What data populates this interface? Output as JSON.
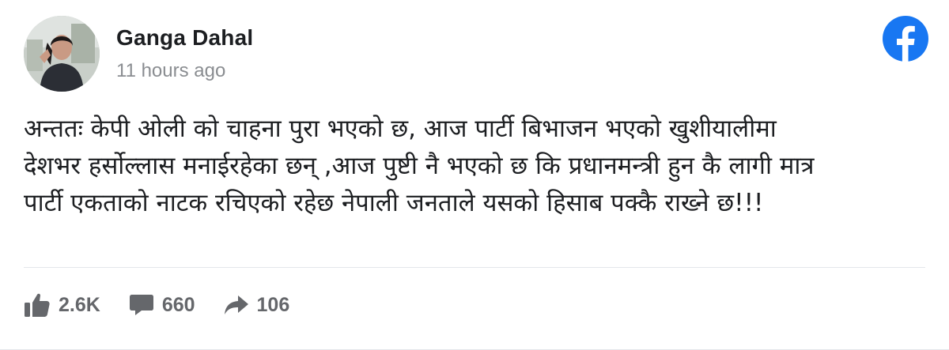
{
  "post": {
    "author": "Ganga Dahal",
    "timestamp": "11 hours ago",
    "text": "अन्ततः केपी ओली को चाहना पुरा भएको छ, आज पार्टी बिभाजन भएको खुशीयालीमा\nदेशभर हर्सोल्लास मनाईरहेका छन् ,आज पुष्टी नै भएको छ कि प्रधानमन्त्री हुन कै लागी मात्र\nपार्टी एकताको नाटक रचिएको रहेछ नेपाली जनताले यसको हिसाब पक्कै राख्ने छ!!!"
  },
  "brand": {
    "icon": "facebook-icon",
    "color": "#1877f2"
  },
  "stats": {
    "likes": "2.6K",
    "comments": "660",
    "shares": "106",
    "icon_color": "#65676b"
  }
}
